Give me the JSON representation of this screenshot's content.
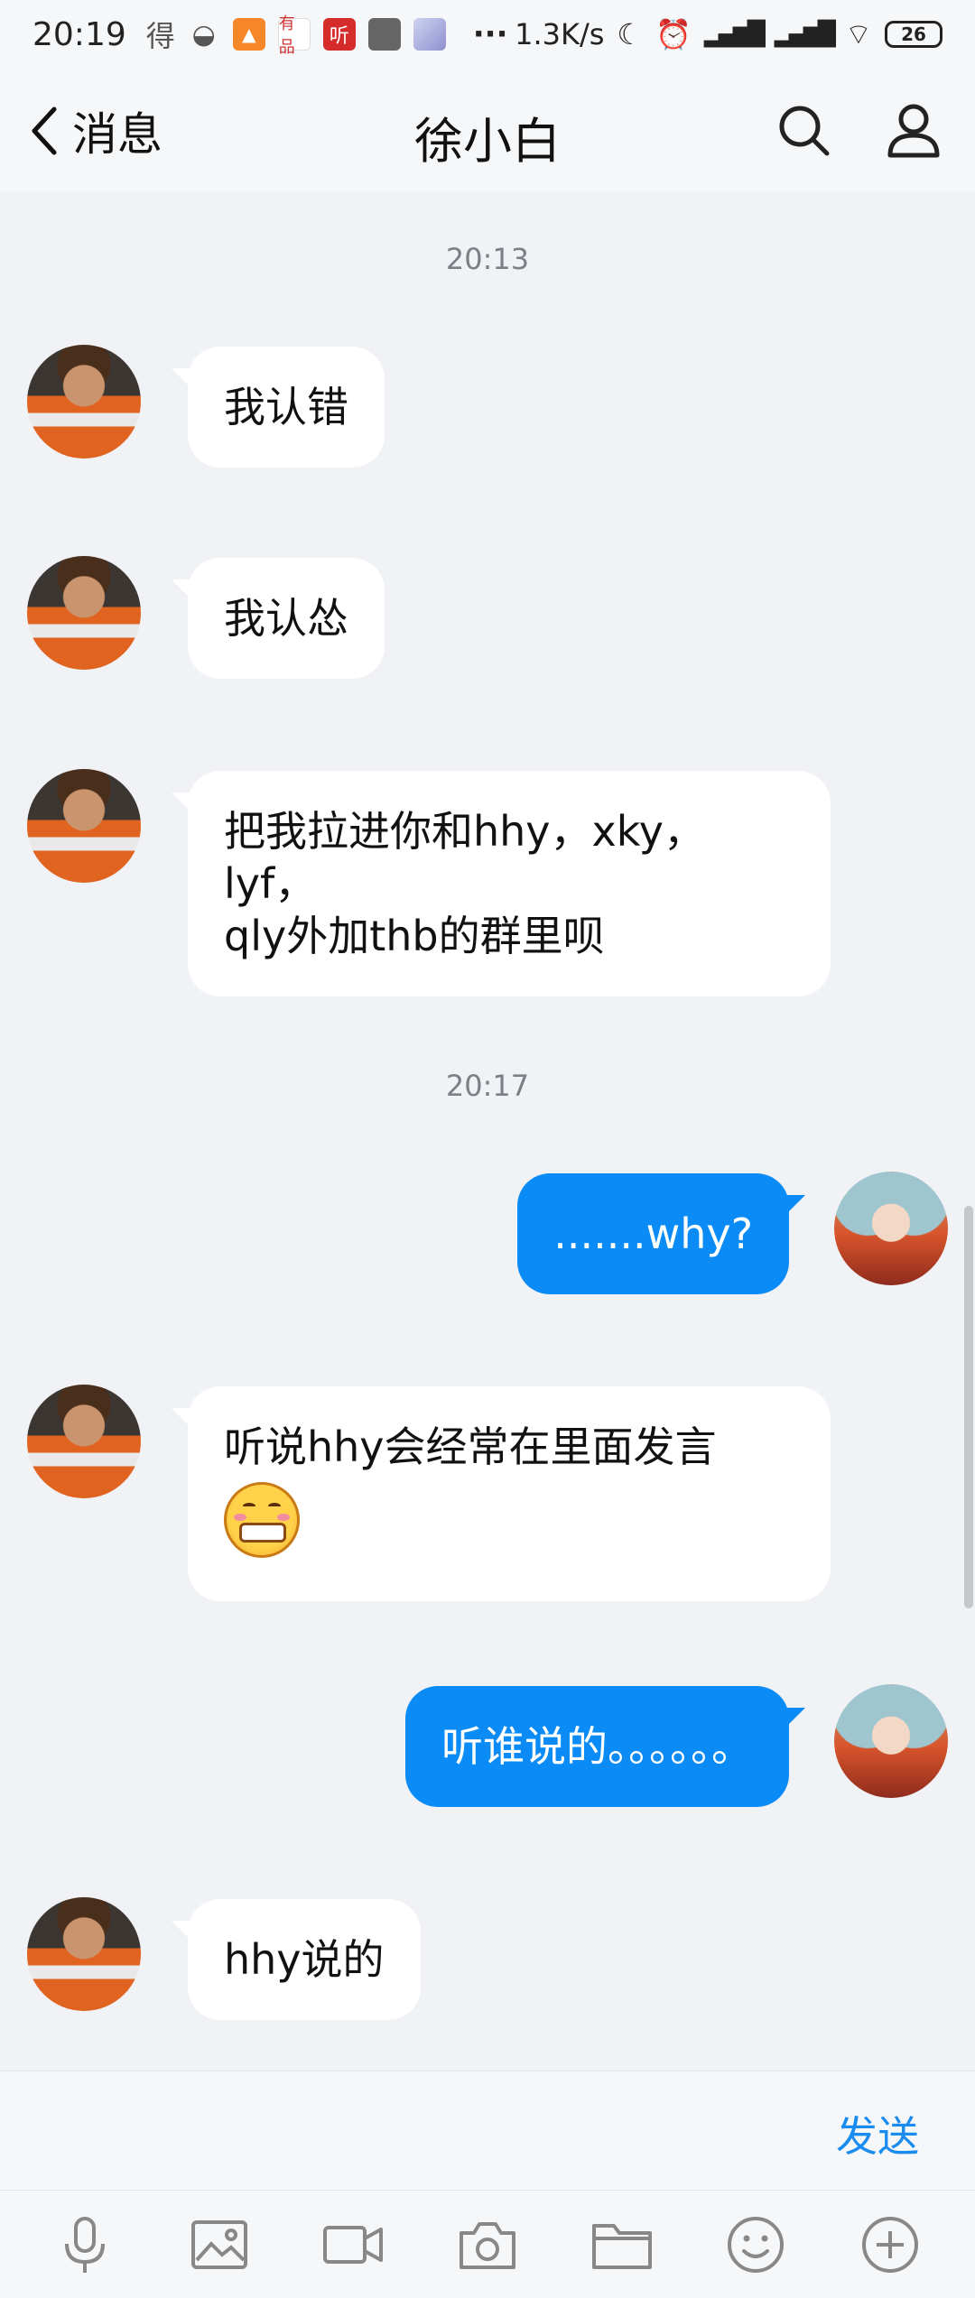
{
  "status_bar": {
    "time": "20:19",
    "network_speed": "1.3K/s",
    "battery": "26",
    "app_icons": [
      "得",
      "wechat-icon",
      "app-icon",
      "有品",
      "听",
      "square-icon",
      "avatar-app-icon",
      "···"
    ]
  },
  "header": {
    "back_label": "消息",
    "title": "徐小白"
  },
  "messages": [
    {
      "type": "time",
      "text": "20:13"
    },
    {
      "type": "in",
      "text": "我认错"
    },
    {
      "type": "in",
      "text": "我认怂"
    },
    {
      "type": "in",
      "lines": [
        "把我拉进你和hhy，xky，lyf，",
        "qly外加thb的群里呗"
      ]
    },
    {
      "type": "time",
      "text": "20:17"
    },
    {
      "type": "out",
      "text": ".......why?"
    },
    {
      "type": "in",
      "text": "听说hhy会经常在里面发言",
      "emoji": "grin-emoji"
    },
    {
      "type": "out",
      "text": "听谁说的。。。。。。"
    },
    {
      "type": "in",
      "text": "hhy说的"
    }
  ],
  "input": {
    "value": "",
    "send_label": "发送"
  },
  "toolbar": [
    "mic-icon",
    "image-icon",
    "video-icon",
    "camera-icon",
    "folder-icon",
    "emoji-icon",
    "plus-icon"
  ],
  "colors": {
    "accent": "#0a8bf6",
    "background": "#f1f2f6",
    "bubble_in": "#ffffff"
  }
}
